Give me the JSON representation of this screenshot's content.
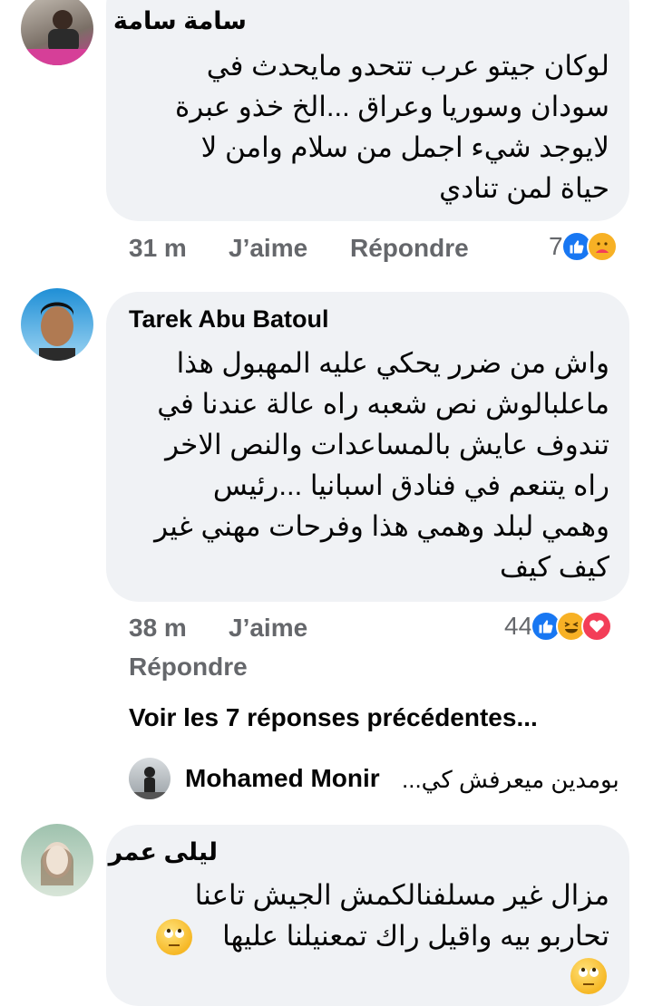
{
  "comments": [
    {
      "author": "سامة سامة",
      "lines": [
        "لوكان جيتو عرب تتحدو مايحدث في",
        "سودان وسوريا وعراق ...الخ خذو عبرة",
        "لايوجد شيء اجمل من سلام وامن لا",
        "حياة لمن تنادي"
      ],
      "time": "31 m",
      "like_label": "J’aime",
      "reply_label": "Répondre",
      "reaction_count": "7",
      "reactions": [
        "like-icon",
        "care-icon"
      ]
    },
    {
      "author": "Tarek Abu Batoul",
      "lines": [
        "واش من ضرر يحكي عليه المهبول هذا",
        "ماعلبالوش نص شعبه راه عالة عندنا في",
        "تندوف عايش بالمساعدات والنص الاخر",
        "راه يتنعم في فنادق اسبانيا ...رئيس",
        "وهمي لبلد وهمي هذا وفرحات مهني غير",
        "كيف كيف"
      ],
      "time": "38 m",
      "like_label": "J’aime",
      "reply_label": "Répondre",
      "reaction_count": "44",
      "reactions": [
        "like-icon",
        "haha-icon",
        "love-icon"
      ]
    },
    {
      "author": "ليلى عمر",
      "lines": [
        "مزال غير مسلفنالكمش الجيش تاعنا",
        "تحاربو بيه واقيل راك تمعنيلنا عليها"
      ]
    }
  ],
  "replies_link": "Voir les 7 réponses précédentes...",
  "reply_preview": {
    "author": "Mohamed Monir",
    "text": "بومدين ميعرفش كي..."
  },
  "colors": {
    "bubble": "#f0f2f5",
    "meta": "#65676b",
    "like": "#1877f2",
    "love": "#f33e58",
    "haha": "#f7b125"
  }
}
